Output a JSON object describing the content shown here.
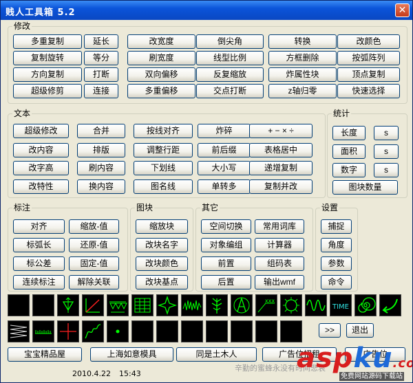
{
  "window": {
    "title": "贱人工具箱  5.2",
    "close_glyph": "✕"
  },
  "groups": {
    "modify": "修改",
    "text": "文本",
    "stats": "统计",
    "dim": "标注",
    "block": "图块",
    "other": "其它",
    "settings": "设置"
  },
  "modify": {
    "rows": [
      [
        "多重复制",
        "延长",
        "改宽度",
        "倒尖角",
        "转换",
        "改颜色"
      ],
      [
        "复制旋转",
        "等分",
        "刷宽度",
        "线型比例",
        "方框删除",
        "按弧阵列"
      ],
      [
        "方向复制",
        "打断",
        "双向偏移",
        "反复缩放",
        "炸属性块",
        "顶点复制"
      ],
      [
        "超级修剪",
        "连接",
        "多重偏移",
        "交点打断",
        "z轴归零",
        "快速选择"
      ]
    ]
  },
  "text": {
    "rows": [
      [
        "超级修改",
        "合并",
        "按线对齐",
        "炸碎",
        "+ − × ÷"
      ],
      [
        "改内容",
        "排版",
        "调整行距",
        "前后缀",
        "表格居中"
      ],
      [
        "改字高",
        "刷内容",
        "下划线",
        "大小写",
        "递增复制"
      ],
      [
        "改特性",
        "换内容",
        "图名线",
        "单转多",
        "复制并改"
      ]
    ]
  },
  "stats": {
    "rows": [
      [
        "长度",
        "s"
      ],
      [
        "面积",
        "s"
      ],
      [
        "数字",
        "s"
      ]
    ],
    "block_count": "图块数量"
  },
  "dim": {
    "rows": [
      [
        "对齐",
        "缩放-值"
      ],
      [
        "标弧长",
        "还原-值"
      ],
      [
        "标公差",
        "固定-值"
      ],
      [
        "连续标注",
        "解除关联"
      ]
    ]
  },
  "block": {
    "items": [
      "缩放块",
      "改块名字",
      "改块颜色",
      "改块基点"
    ]
  },
  "other": {
    "rows": [
      [
        "空间切换",
        "常用词库"
      ],
      [
        "对象编组",
        "计算器"
      ],
      [
        "前置",
        "组码表"
      ],
      [
        "后置",
        "输出wmf"
      ]
    ]
  },
  "settings": {
    "items": [
      "捕捉",
      "角度",
      "参数",
      "命令"
    ]
  },
  "icons": {
    "row1": [
      "blank-1",
      "blank-2",
      "triangle-arrows-icon",
      "angle-red-icon",
      "triangles-row-icon",
      "grid-table-icon",
      "star-diamond-icon",
      "zigzag-wave-icon",
      "tree-plant-icon",
      "compass-a-icon",
      "xxx-slope-icon",
      "gear-circle-icon",
      "sine-wave-icon",
      "time-text-icon",
      "spiral-icon",
      "curved-arrow-icon"
    ],
    "row2": [
      "spring-icon",
      "ruler-icon",
      "crosshair-icon",
      "squiggle-icon",
      "dot-icon",
      "blank-6",
      "blank-7",
      "blank-8",
      "blank-9",
      "blank-10",
      "blank-11",
      "blank-12"
    ],
    "time_label": "TIME",
    "xxx_label": "xxx",
    "colors": {
      "green": "#00ff00",
      "red": "#ff2020",
      "cyan": "#30e0e0",
      "white": "#e0e0e0"
    }
  },
  "nav": {
    "next": ">>",
    "exit": "退出"
  },
  "links": [
    "宝宝精品屋",
    "上海如意模具",
    "同是土木人",
    "广告位招租",
    "广告位"
  ],
  "status": {
    "date": "2010.4.22",
    "time": "15:43",
    "watermark": "辛勤的蜜蜂永没有时间悲哀"
  },
  "brand": {
    "text1": "asp",
    "text2": "ku",
    "text3": ".com",
    "sub": "免费网站源码下载站"
  }
}
